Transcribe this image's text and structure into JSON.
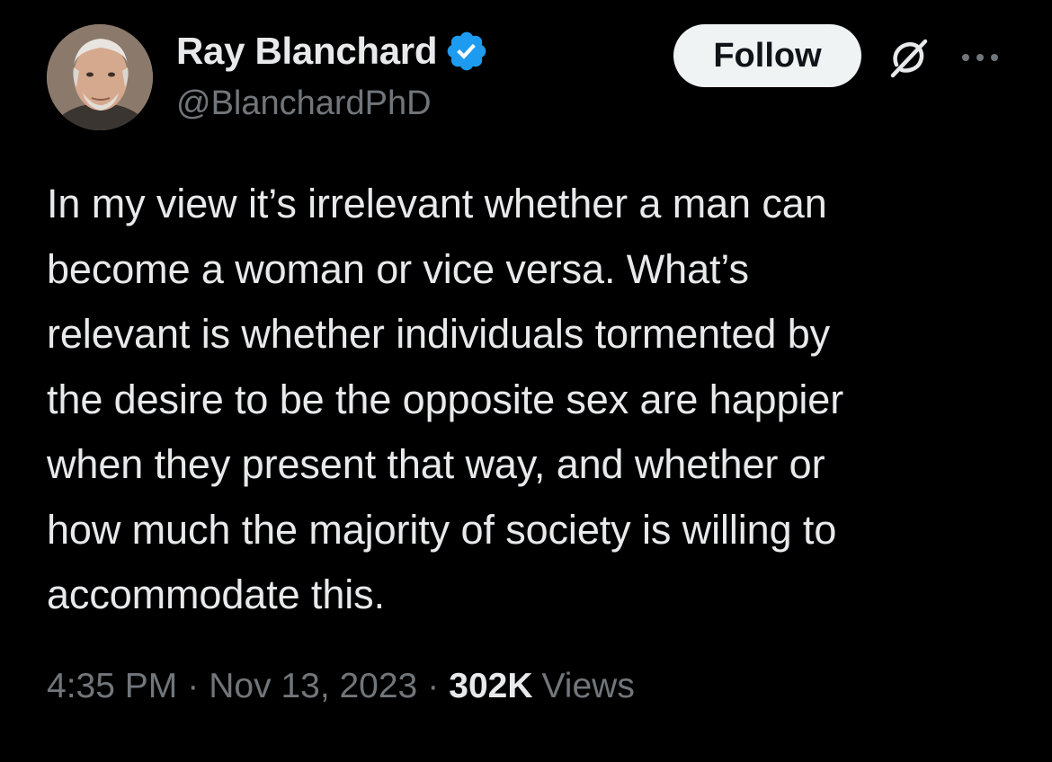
{
  "author": {
    "display_name": "Ray Blanchard",
    "handle": "@BlanchardPhD",
    "verified": true
  },
  "actions": {
    "follow_label": "Follow",
    "grok_icon": "grok-icon",
    "more_icon": "more-icon"
  },
  "tweet": {
    "text": "In my view it’s irrelevant whether a man can\nbecome a woman or vice versa. What’s\nrelevant is whether individuals tormented by\nthe desire to be the opposite sex are happier\nwhen they present that way, and whether or\nhow much the majority of society is willing to\naccommodate this."
  },
  "meta": {
    "time": "4:35 PM",
    "separator": "·",
    "date": "Nov 13, 2023",
    "views_count": "302K",
    "views_label": "Views"
  },
  "colors": {
    "background": "#000000",
    "primary_text": "#e7e9ea",
    "secondary_text": "#71767b",
    "verified_blue": "#1d9bf0",
    "follow_bg": "#eff3f4"
  }
}
